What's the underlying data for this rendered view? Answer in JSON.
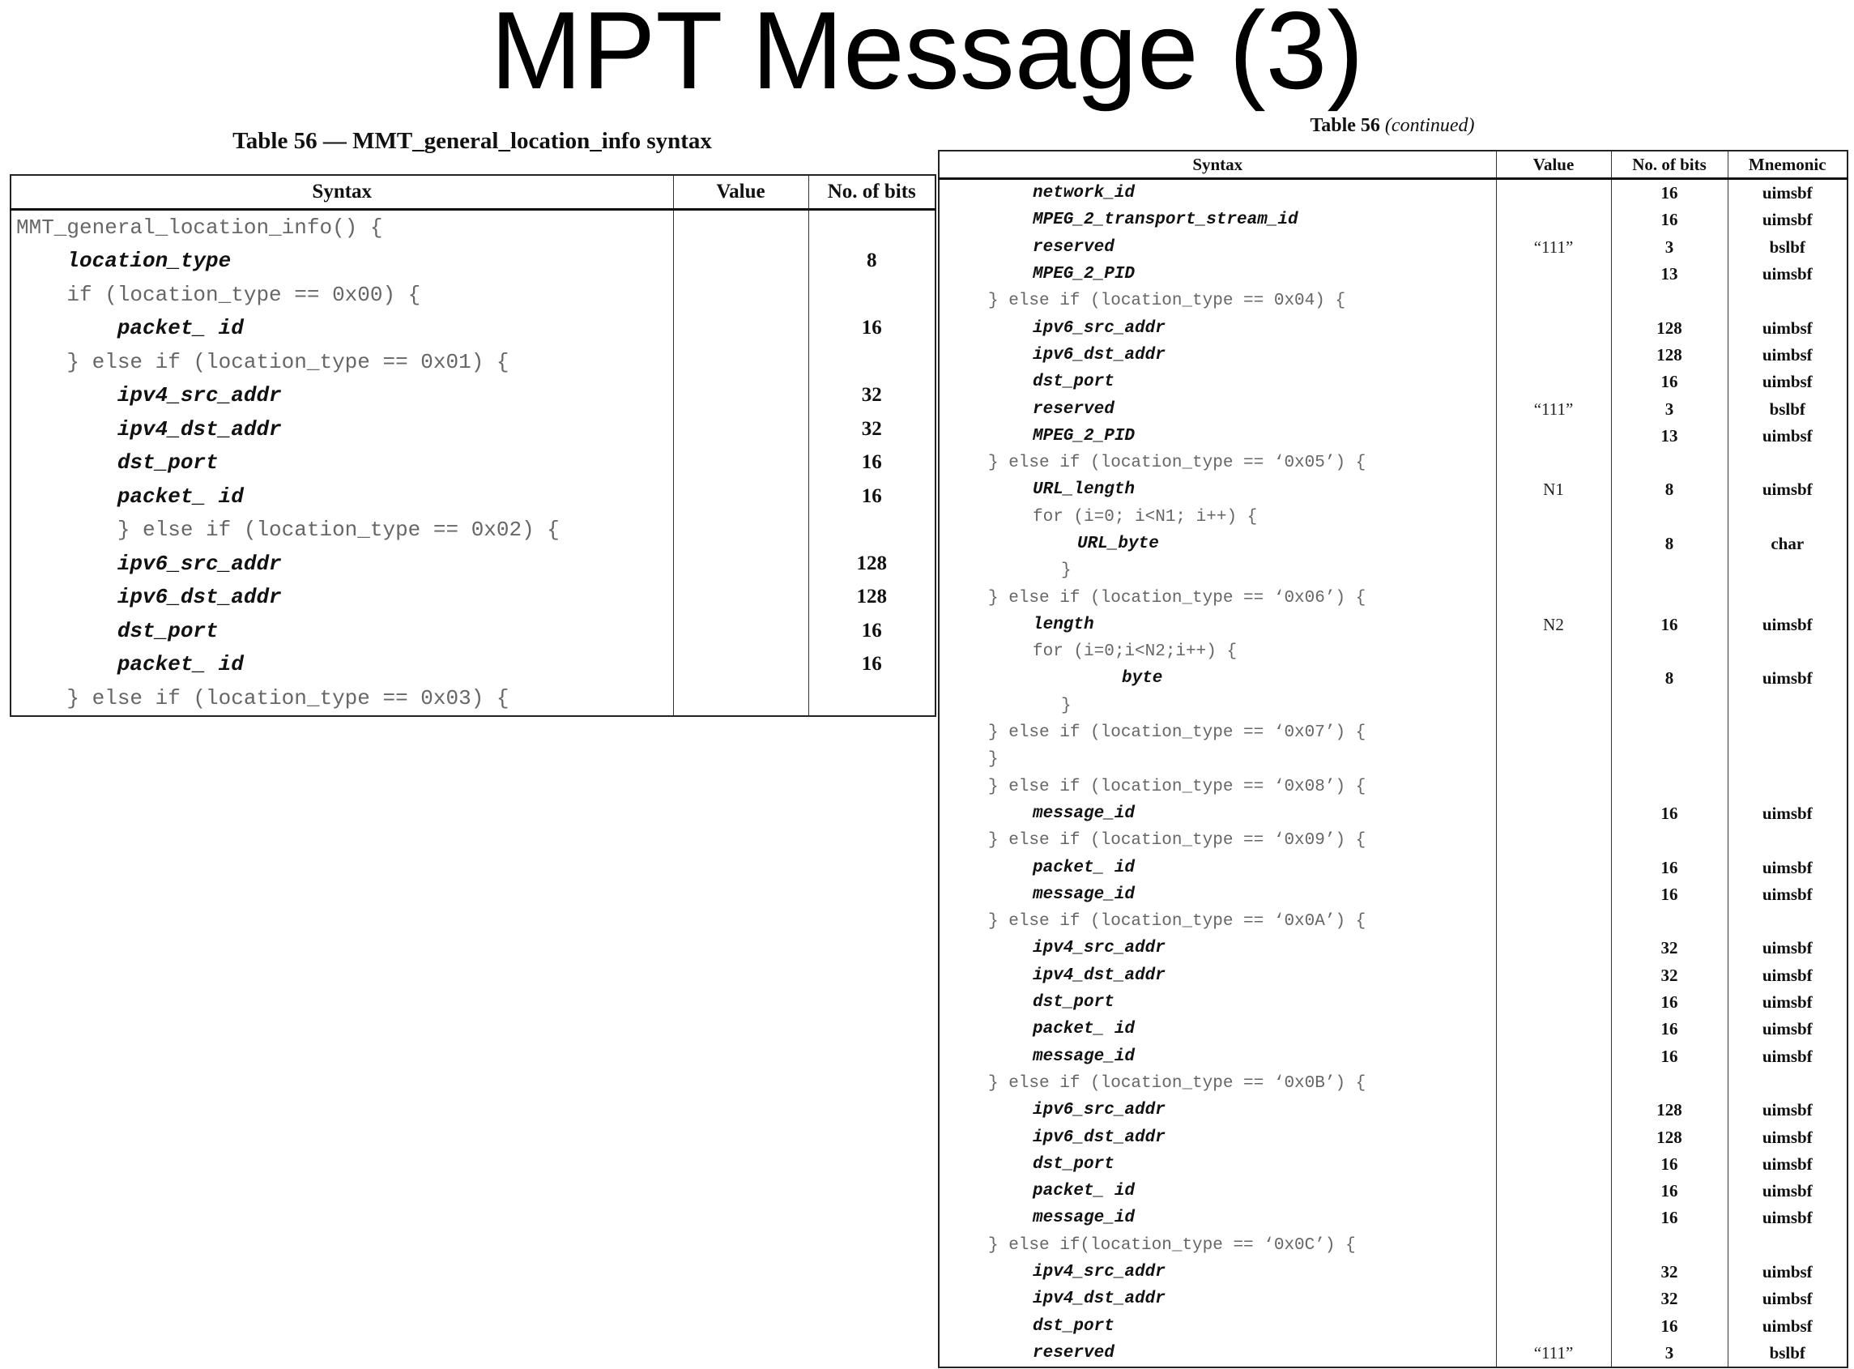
{
  "slide": {
    "title": "MPT Message (3)"
  },
  "left_table": {
    "caption": "Table 56 — MMT_general_location_info syntax",
    "headers": {
      "syntax": "Syntax",
      "value": "Value",
      "bits": "No. of bits"
    },
    "rows": [
      {
        "syntax": "MMT_general_location_info() {",
        "field": false,
        "value": "",
        "bits": ""
      },
      {
        "syntax": "    location_type",
        "field": true,
        "value": "",
        "bits": "8"
      },
      {
        "syntax": "    if (location_type == 0x00) {",
        "field": false,
        "value": "",
        "bits": ""
      },
      {
        "syntax": "        packet_ id",
        "field": true,
        "value": "",
        "bits": "16"
      },
      {
        "syntax": "    } else if (location_type == 0x01) {",
        "field": false,
        "value": "",
        "bits": ""
      },
      {
        "syntax": "        ipv4_src_addr",
        "field": true,
        "value": "",
        "bits": "32"
      },
      {
        "syntax": "        ipv4_dst_addr",
        "field": true,
        "value": "",
        "bits": "32"
      },
      {
        "syntax": "        dst_port",
        "field": true,
        "value": "",
        "bits": "16"
      },
      {
        "syntax": "        packet_ id",
        "field": true,
        "value": "",
        "bits": "16"
      },
      {
        "syntax": "        } else if (location_type == 0x02) {",
        "field": false,
        "value": "",
        "bits": ""
      },
      {
        "syntax": "        ipv6_src_addr",
        "field": true,
        "value": "",
        "bits": "128"
      },
      {
        "syntax": "        ipv6_dst_addr",
        "field": true,
        "value": "",
        "bits": "128"
      },
      {
        "syntax": "        dst_port",
        "field": true,
        "value": "",
        "bits": "16"
      },
      {
        "syntax": "        packet_ id",
        "field": true,
        "value": "",
        "bits": "16"
      },
      {
        "syntax": "    } else if (location_type == 0x03) {",
        "field": false,
        "value": "",
        "bits": ""
      }
    ]
  },
  "right_table": {
    "caption_main": "Table 56",
    "caption_note": "(continued)",
    "headers": {
      "syntax": "Syntax",
      "value": "Value",
      "bits": "No. of bits",
      "mnemonic": "Mnemonic"
    },
    "rows": [
      {
        "syntax": "network_id",
        "field": true,
        "value": "",
        "bits": "16",
        "mnemonic": "uimsbf"
      },
      {
        "syntax": "MPEG_2_transport_stream_id",
        "field": true,
        "value": "",
        "bits": "16",
        "mnemonic": "uimsbf"
      },
      {
        "syntax": "reserved",
        "field": true,
        "value": "“111”",
        "bits": "3",
        "mnemonic": "bslbf"
      },
      {
        "syntax": "MPEG_2_PID",
        "field": true,
        "value": "",
        "bits": "13",
        "mnemonic": "uimsbf"
      },
      {
        "syntax": "} else if (location_type == 0x04) {",
        "field": false,
        "value": "",
        "bits": "",
        "mnemonic": ""
      },
      {
        "syntax": "ipv6_src_addr",
        "field": true,
        "value": "",
        "bits": "128",
        "mnemonic": "uimbsf"
      },
      {
        "syntax": "ipv6_dst_addr",
        "field": true,
        "value": "",
        "bits": "128",
        "mnemonic": "uimbsf"
      },
      {
        "syntax": "dst_port",
        "field": true,
        "value": "",
        "bits": "16",
        "mnemonic": "uimbsf"
      },
      {
        "syntax": "reserved",
        "field": true,
        "value": "“111”",
        "bits": "3",
        "mnemonic": "bslbf"
      },
      {
        "syntax": "MPEG_2_PID",
        "field": true,
        "value": "",
        "bits": "13",
        "mnemonic": "uimbsf"
      },
      {
        "syntax": "} else if (location_type == ‘0x05’) {",
        "field": false,
        "value": "",
        "bits": "",
        "mnemonic": ""
      },
      {
        "syntax": "URL_length",
        "field": true,
        "value": "N1",
        "bits": "8",
        "mnemonic": "uimsbf"
      },
      {
        "syntax": "for (i=0; i<N1; i++) {",
        "field": false,
        "value": "",
        "bits": "",
        "mnemonic": ""
      },
      {
        "syntax": "URL_byte",
        "field": true,
        "value": "",
        "bits": "8",
        "mnemonic": "char"
      },
      {
        "syntax": "}",
        "field": false,
        "value": "",
        "bits": "",
        "mnemonic": ""
      },
      {
        "syntax": "} else if (location_type == ‘0x06’) {",
        "field": false,
        "value": "",
        "bits": "",
        "mnemonic": ""
      },
      {
        "syntax": "length",
        "field": true,
        "value": "N2",
        "bits": "16",
        "mnemonic": "uimsbf"
      },
      {
        "syntax": "for (i=0;i<N2;i++) {",
        "field": false,
        "value": "",
        "bits": "",
        "mnemonic": ""
      },
      {
        "syntax": "byte",
        "field": true,
        "value": "",
        "bits": "8",
        "mnemonic": "uimsbf"
      },
      {
        "syntax": "}",
        "field": false,
        "value": "",
        "bits": "",
        "mnemonic": ""
      },
      {
        "syntax": "} else if (location_type == ‘0x07’) {",
        "field": false,
        "value": "",
        "bits": "",
        "mnemonic": ""
      },
      {
        "syntax": "}",
        "field": false,
        "value": "",
        "bits": "",
        "mnemonic": ""
      },
      {
        "syntax": "} else if (location_type == ‘0x08’) {",
        "field": false,
        "value": "",
        "bits": "",
        "mnemonic": ""
      },
      {
        "syntax": "message_id",
        "field": true,
        "value": "",
        "bits": "16",
        "mnemonic": "uimsbf"
      },
      {
        "syntax": "} else if (location_type == ‘0x09’) {",
        "field": false,
        "value": "",
        "bits": "",
        "mnemonic": ""
      },
      {
        "syntax": "packet_ id",
        "field": true,
        "value": "",
        "bits": "16",
        "mnemonic": "uimsbf"
      },
      {
        "syntax": "message_id",
        "field": true,
        "value": "",
        "bits": "16",
        "mnemonic": "uimsbf"
      },
      {
        "syntax": "} else if (location_type == ‘0x0A’) {",
        "field": false,
        "value": "",
        "bits": "",
        "mnemonic": ""
      },
      {
        "syntax": "ipv4_src_addr",
        "field": true,
        "value": "",
        "bits": "32",
        "mnemonic": "uimsbf"
      },
      {
        "syntax": "ipv4_dst_addr",
        "field": true,
        "value": "",
        "bits": "32",
        "mnemonic": "uimsbf"
      },
      {
        "syntax": "dst_port",
        "field": true,
        "value": "",
        "bits": "16",
        "mnemonic": "uimsbf"
      },
      {
        "syntax": "packet_ id",
        "field": true,
        "value": "",
        "bits": "16",
        "mnemonic": "uimsbf"
      },
      {
        "syntax": "message_id",
        "field": true,
        "value": "",
        "bits": "16",
        "mnemonic": "uimsbf"
      },
      {
        "syntax": "} else if (location_type == ‘0x0B’) {",
        "field": false,
        "value": "",
        "bits": "",
        "mnemonic": ""
      },
      {
        "syntax": "ipv6_src_addr",
        "field": true,
        "value": "",
        "bits": "128",
        "mnemonic": "uimsbf"
      },
      {
        "syntax": "ipv6_dst_addr",
        "field": true,
        "value": "",
        "bits": "128",
        "mnemonic": "uimsbf"
      },
      {
        "syntax": "dst_port",
        "field": true,
        "value": "",
        "bits": "16",
        "mnemonic": "uimsbf"
      },
      {
        "syntax": "packet_ id",
        "field": true,
        "value": "",
        "bits": "16",
        "mnemonic": "uimsbf"
      },
      {
        "syntax": "message_id",
        "field": true,
        "value": "",
        "bits": "16",
        "mnemonic": "uimsbf"
      },
      {
        "syntax": "} else if(location_type == ‘0x0C’) {",
        "field": false,
        "value": "",
        "bits": "",
        "mnemonic": ""
      },
      {
        "syntax": "ipv4_src_addr",
        "field": true,
        "value": "",
        "bits": "32",
        "mnemonic": "uimbsf"
      },
      {
        "syntax": "ipv4_dst_addr",
        "field": true,
        "value": "",
        "bits": "32",
        "mnemonic": "uimbsf"
      },
      {
        "syntax": "dst_port",
        "field": true,
        "value": "",
        "bits": "16",
        "mnemonic": "uimbsf"
      },
      {
        "syntax": "reserved",
        "field": true,
        "value": "“111”",
        "bits": "3",
        "mnemonic": "bslbf"
      }
    ]
  }
}
